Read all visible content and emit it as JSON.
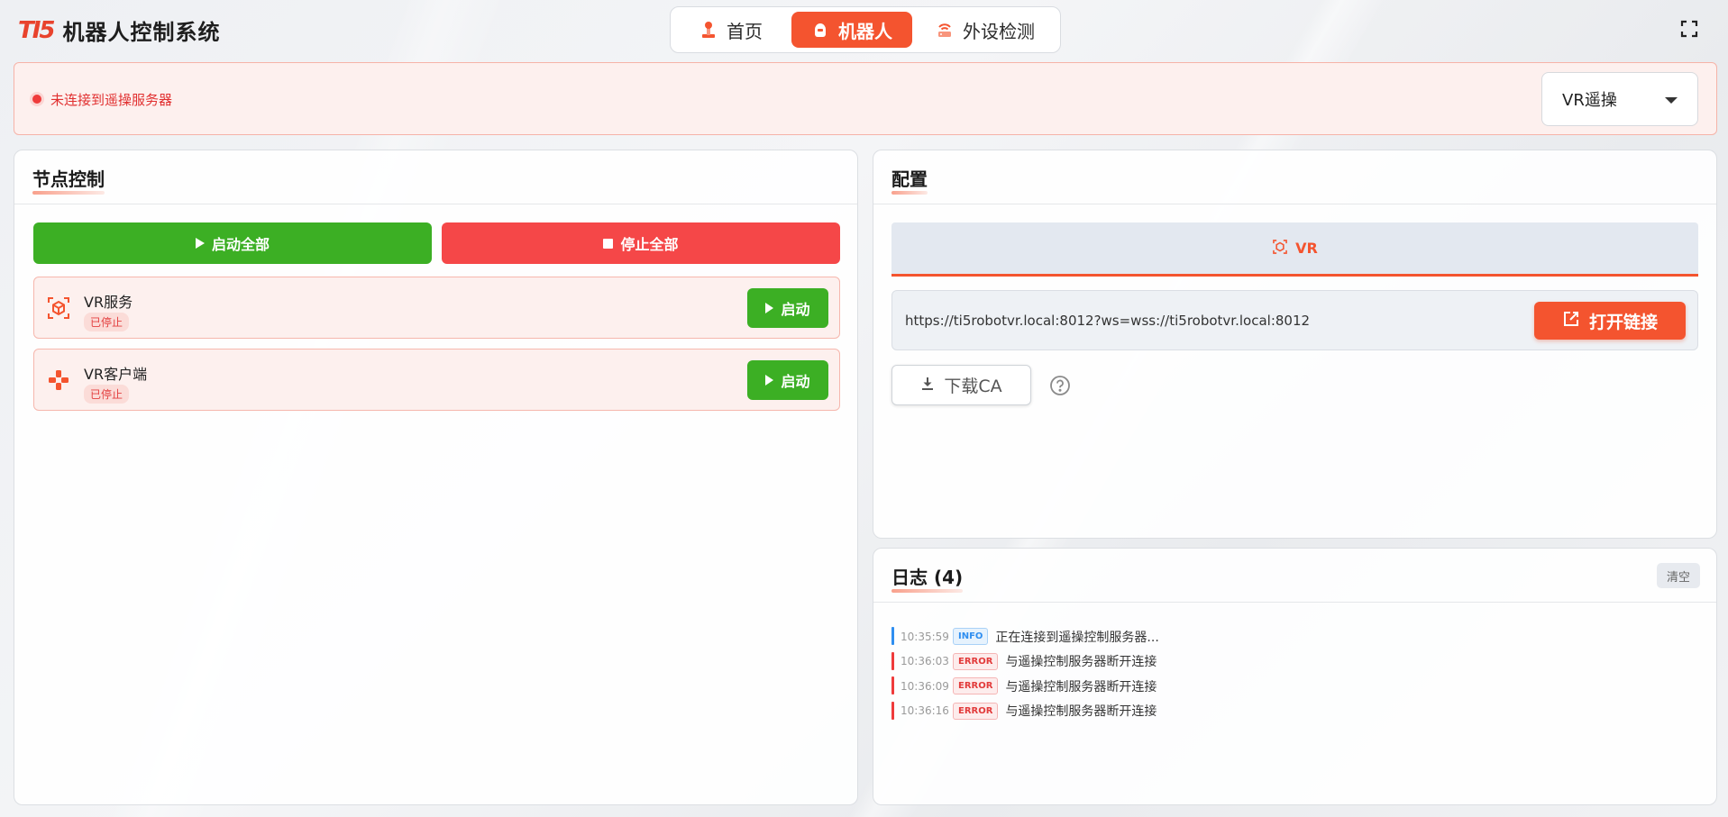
{
  "app": {
    "logo_text": "TI5",
    "title": "机器人控制系统"
  },
  "nav": {
    "tabs": [
      {
        "label": "首页",
        "icon": "robot-arm-icon",
        "active": false
      },
      {
        "label": "机器人",
        "icon": "robot-head-icon",
        "active": true
      },
      {
        "label": "外设检测",
        "icon": "router-icon",
        "active": false
      }
    ]
  },
  "status": {
    "text": "未连接到遥操服务器",
    "color": "#ef3b3b"
  },
  "mode_select": {
    "value": "VR遥操"
  },
  "nodes": {
    "title": "节点控制",
    "start_all_label": "启动全部",
    "stop_all_label": "停止全部",
    "items": [
      {
        "name": "VR服务",
        "status": "已停止",
        "icon": "vr-cube-icon",
        "action_label": "启动"
      },
      {
        "name": "VR客户端",
        "status": "已停止",
        "icon": "gamepad-icon",
        "action_label": "启动"
      }
    ]
  },
  "config": {
    "title": "配置",
    "tab_label": "VR",
    "url": "https://ti5robotvr.local:8012?ws=wss://ti5robotvr.local:8012",
    "open_link_label": "打开链接",
    "download_ca_label": "下载CA"
  },
  "logs": {
    "title": "日志 (4)",
    "clear_label": "清空",
    "entries": [
      {
        "time": "10:35:59",
        "level": "INFO",
        "message": "正在连接到遥操控制服务器..."
      },
      {
        "time": "10:36:03",
        "level": "ERROR",
        "message": "与遥操控制服务器断开连接"
      },
      {
        "time": "10:36:09",
        "level": "ERROR",
        "message": "与遥操控制服务器断开连接"
      },
      {
        "time": "10:36:16",
        "level": "ERROR",
        "message": "与遥操控制服务器断开连接"
      }
    ]
  },
  "colors": {
    "accent": "#f4542f",
    "success": "#3caf24",
    "danger": "#f54748",
    "info": "#2f8ef0"
  }
}
